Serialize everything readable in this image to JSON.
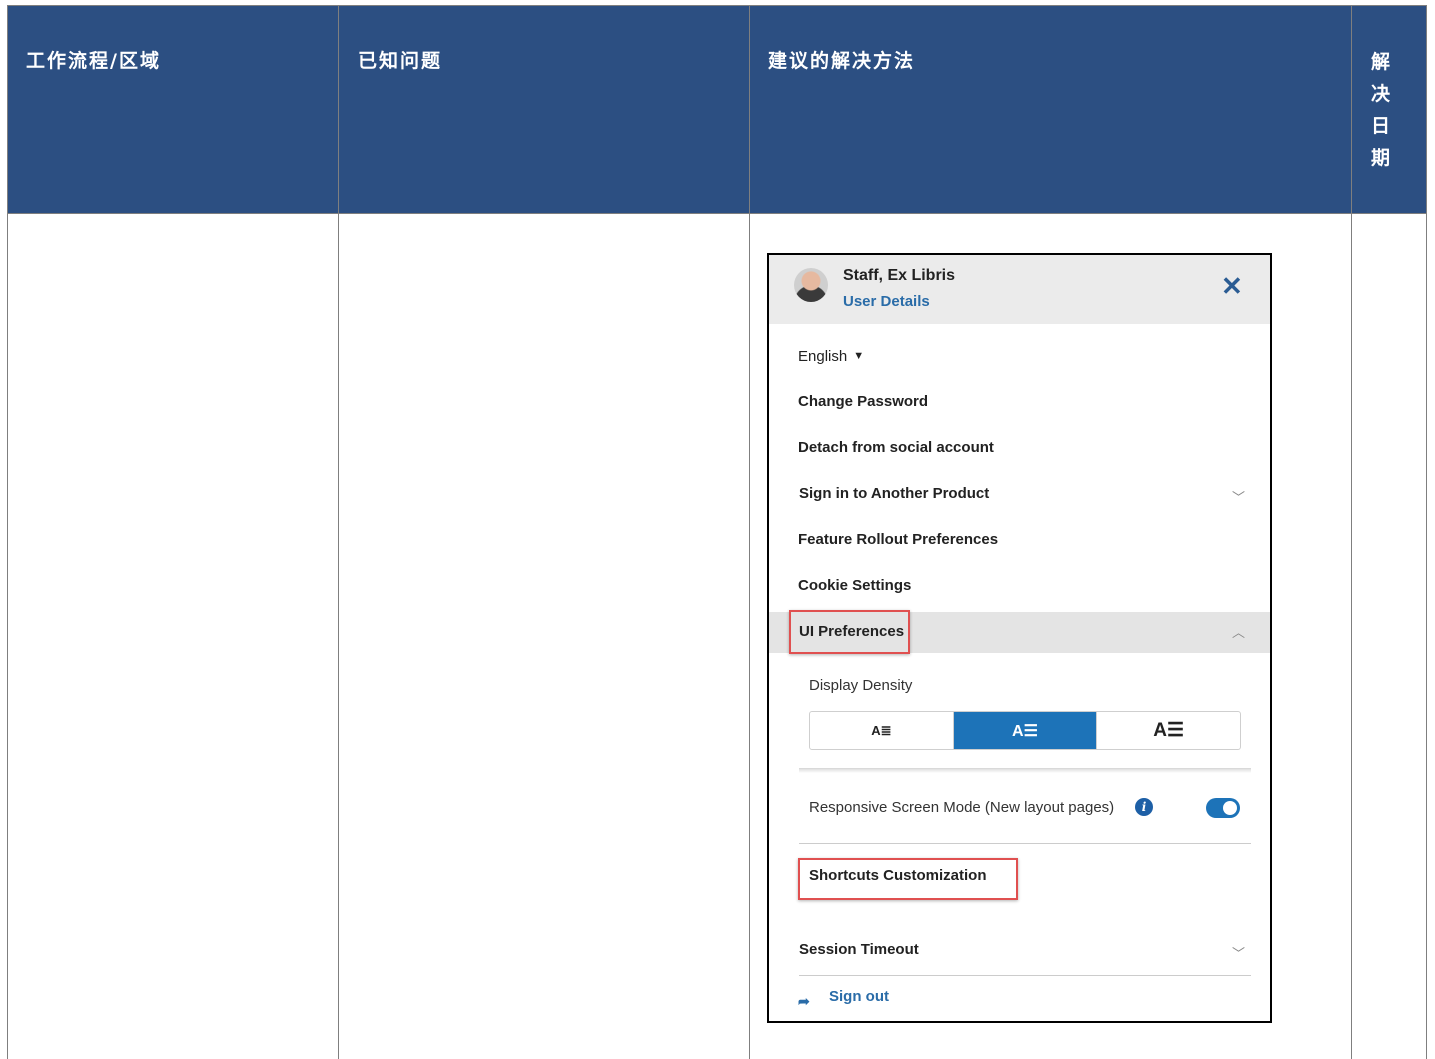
{
  "table": {
    "headers": [
      "工作流程/区域",
      "已知问题",
      "建议的解决方法",
      "解决日期"
    ],
    "colors": {
      "header_bg": "#2c4f82",
      "header_text": "#ffffff"
    }
  },
  "panel": {
    "user_name": "Staff, Ex Libris",
    "user_details": "User Details",
    "close_icon": "close-icon",
    "language": "English",
    "language_caret": "▼",
    "items": {
      "change_password": "Change Password",
      "detach_social": "Detach from social account",
      "sign_in_another": "Sign in to Another Product",
      "feature_rollout": "Feature Rollout Preferences",
      "cookie_settings": "Cookie Settings",
      "ui_preferences": "UI Preferences",
      "display_density": "Display Density",
      "responsive_mode": "Responsive Screen Mode (New layout pages)",
      "shortcuts": "Shortcuts Customization",
      "session_timeout": "Session Timeout",
      "sign_out": "Sign out"
    },
    "density_options": [
      "A≣",
      "A☰",
      "A☰"
    ],
    "density_selected_index": 1,
    "responsive_toggle_on": true,
    "colors": {
      "accent": "#1d73b8",
      "link": "#2a6ca8",
      "highlight_box": "#e05050"
    }
  }
}
